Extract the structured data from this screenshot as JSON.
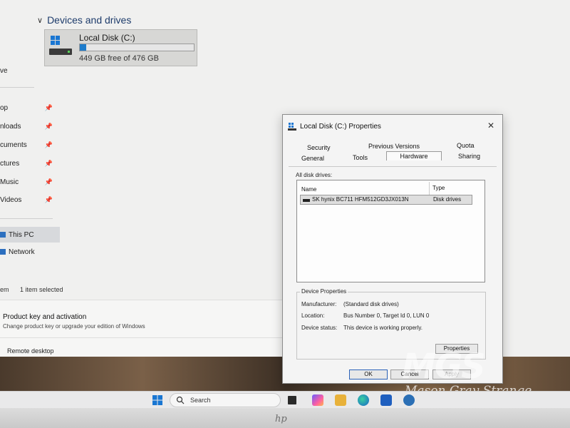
{
  "explorer": {
    "section_header": "Devices and drives",
    "drive": {
      "name": "Local Disk (C:)",
      "free_text": "449 GB free of 476 GB",
      "used_fraction": 0.057
    },
    "nav": {
      "truncated_top": "ve",
      "items": [
        {
          "label": "op",
          "pinned": true
        },
        {
          "label": "nloads",
          "pinned": true
        },
        {
          "label": "cuments",
          "pinned": true
        },
        {
          "label": "ctures",
          "pinned": true
        },
        {
          "label": "Music",
          "pinned": true
        },
        {
          "label": "Videos",
          "pinned": true
        }
      ],
      "this_pc": "This PC",
      "network": "Network"
    },
    "status": {
      "items_text": "em",
      "selected_text": "1 item selected"
    }
  },
  "settings": {
    "product_key_title": "Product key and activation",
    "product_key_sub": "Change product key or upgrade your edition of Windows",
    "remote_desktop": "Remote desktop"
  },
  "dialog": {
    "title": "Local Disk (C:) Properties",
    "tabs": {
      "security": "Security",
      "previous_versions": "Previous Versions",
      "quota": "Quota",
      "general": "General",
      "tools": "Tools",
      "hardware": "Hardware",
      "sharing": "Sharing"
    },
    "all_disk_drives_label": "All disk drives:",
    "columns": {
      "name": "Name",
      "type": "Type"
    },
    "drives": [
      {
        "name": "SK hynix BC711 HFM512GD3JX013N",
        "type": "Disk drives"
      }
    ],
    "device_properties": {
      "legend": "Device Properties",
      "manufacturer_label": "Manufacturer:",
      "manufacturer_value": "(Standard disk drives)",
      "location_label": "Location:",
      "location_value": "Bus Number 0, Target Id 0, LUN 0",
      "status_label": "Device status:",
      "status_value": "This device is working properly."
    },
    "buttons": {
      "properties": "Properties",
      "ok": "OK",
      "cancel": "Cancel",
      "apply": "Apply"
    }
  },
  "taskbar": {
    "search_placeholder": "Search",
    "apps": [
      "task-view-icon",
      "copilot-icon",
      "file-explorer-icon",
      "edge-icon",
      "store-icon",
      "settings-icon"
    ]
  },
  "watermark": {
    "letters": "MGS",
    "name": "Mason Gray Strange"
  },
  "bezel": {
    "logo": "hp"
  },
  "colors": {
    "accent": "#1e7ccb",
    "dialog_bg": "#f4f4f4",
    "explorer_bg": "#f0f0ef"
  }
}
